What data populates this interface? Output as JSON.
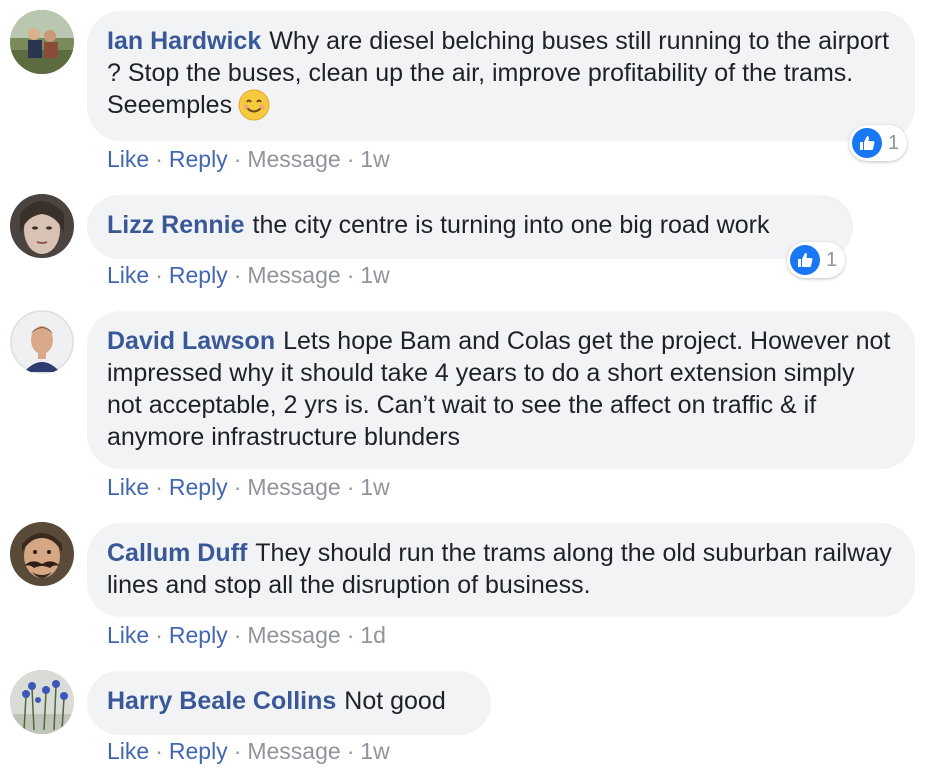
{
  "colors": {
    "author": "#385898",
    "link": "#4267b2",
    "muted": "#90949c",
    "bubble": "#f2f3f5",
    "like_badge": "#1877f2"
  },
  "comments": [
    {
      "author": "Ian Hardwick",
      "text": "Why are diesel belching buses still running to the airport ? Stop the buses, clean up the air, improve profitability of the trams. Seeemples",
      "emoji": "smiling-face-icon",
      "actions": {
        "like": "Like",
        "reply": "Reply",
        "message": "Message",
        "time": "1w"
      },
      "reaction_count": "1"
    },
    {
      "author": "Lizz Rennie",
      "text": "the city centre is turning into one big road work",
      "actions": {
        "like": "Like",
        "reply": "Reply",
        "message": "Message",
        "time": "1w"
      },
      "reaction_count": "1"
    },
    {
      "author": "David Lawson",
      "text": "Lets hope Bam and Colas get the project. However not impressed why it should take 4 years to do a short extension simply not acceptable, 2 yrs is. Can’t wait to see the affect on traffic & if anymore infrastructure blunders",
      "actions": {
        "like": "Like",
        "reply": "Reply",
        "message": "Message",
        "time": "1w"
      }
    },
    {
      "author": "Callum Duff",
      "text": "They should run the trams along the old suburban railway lines and stop all the disruption of business.",
      "actions": {
        "like": "Like",
        "reply": "Reply",
        "message": "Message",
        "time": "1d"
      }
    },
    {
      "author": "Harry Beale Collins",
      "text": "Not good",
      "actions": {
        "like": "Like",
        "reply": "Reply",
        "message": "Message",
        "time": "1w"
      }
    }
  ]
}
